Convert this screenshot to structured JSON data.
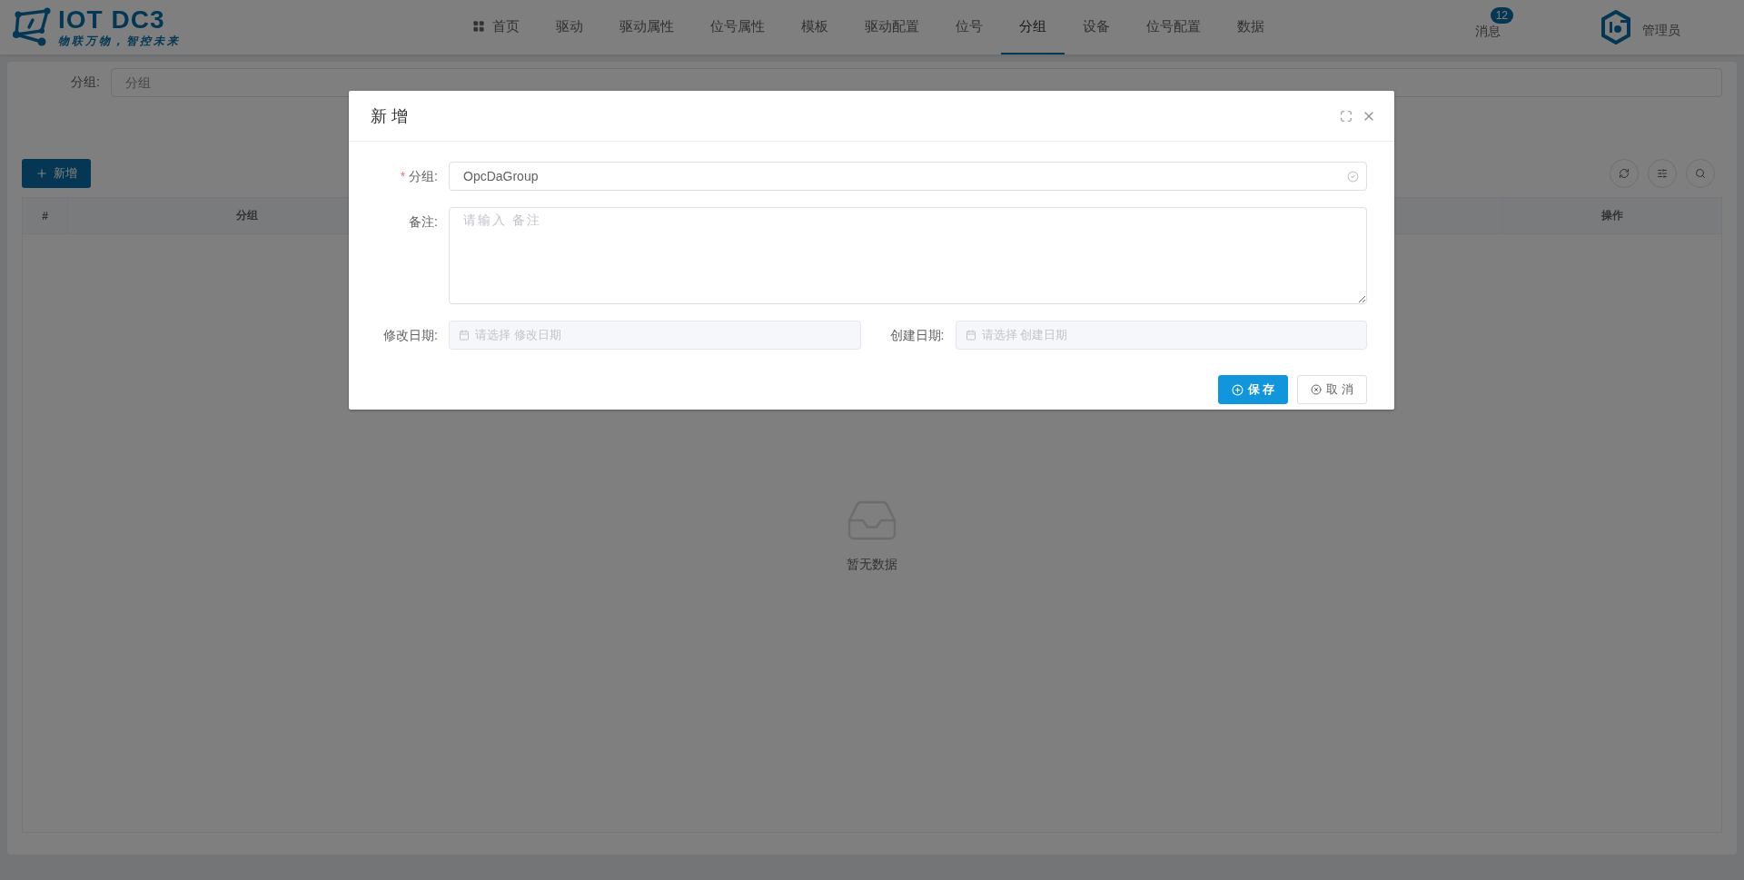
{
  "header": {
    "logo": {
      "title": "IOT DC3",
      "slogan": "物联万物，智控未来"
    },
    "nav": [
      {
        "label": "首页",
        "kind": "home",
        "selected": false
      },
      {
        "label": "驱动",
        "kind": "link",
        "selected": false
      },
      {
        "label": "驱动属性",
        "kind": "link",
        "selected": false
      },
      {
        "label": "位号属性",
        "kind": "link",
        "selected": false
      },
      {
        "label": "模板",
        "kind": "link",
        "selected": false
      },
      {
        "label": "驱动配置",
        "kind": "link",
        "selected": false
      },
      {
        "label": "位号",
        "kind": "link",
        "selected": false
      },
      {
        "label": "分组",
        "kind": "link",
        "selected": true
      },
      {
        "label": "设备",
        "kind": "link",
        "selected": false
      },
      {
        "label": "位号配置",
        "kind": "link",
        "selected": false
      },
      {
        "label": "数据",
        "kind": "link",
        "selected": false
      }
    ],
    "messages": {
      "label": "消息",
      "badge": "12"
    },
    "user": {
      "name": "管理员"
    }
  },
  "search": {
    "label": "分组:",
    "placeholder": "分组"
  },
  "toolbar": {
    "add_button": "新增"
  },
  "table": {
    "columns": [
      "#",
      "分组",
      "操作"
    ],
    "empty_text": "暂无数据"
  },
  "dialog": {
    "title": "新 增",
    "fields": [
      {
        "kind": "text",
        "label": "分组:",
        "required_mark": "*",
        "value": "OpcDaGroup",
        "valid": true
      },
      {
        "kind": "textarea",
        "label": "备注:",
        "placeholder": "请输入 备注"
      }
    ],
    "dates": [
      {
        "label": "修改日期:",
        "placeholder": "请选择 修改日期"
      },
      {
        "label": "创建日期:",
        "placeholder": "请选择 创建日期"
      }
    ],
    "buttons": [
      {
        "label": "保 存",
        "kind": "primary"
      },
      {
        "label": "取 消",
        "kind": "default"
      }
    ]
  }
}
